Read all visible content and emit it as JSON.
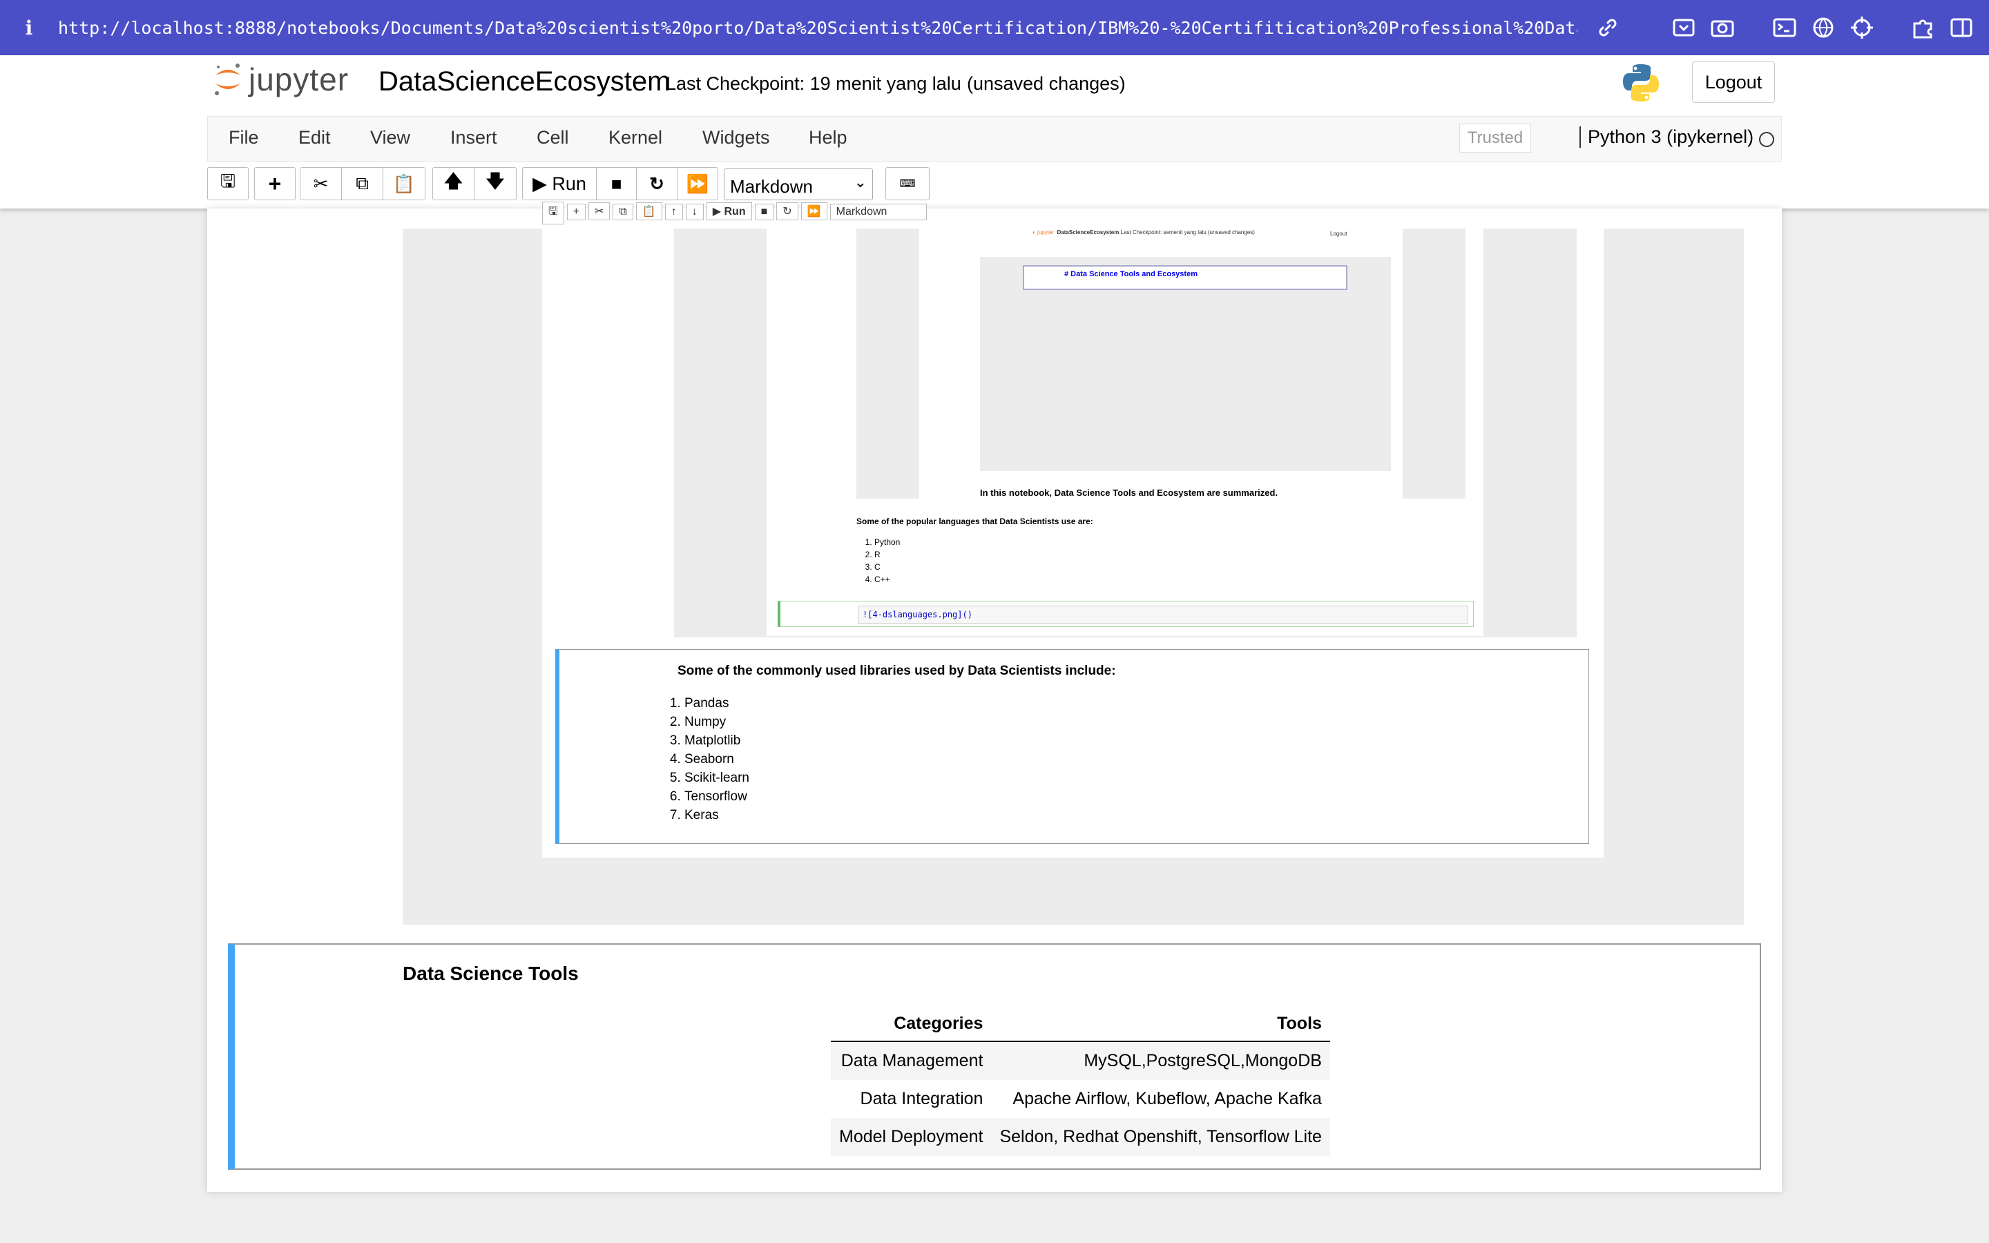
{
  "browser": {
    "info": "i",
    "url": "http://localhost:8888/notebooks/Documents/Data%20scientist%20porto/Data%20Scientist%20Certification/IBM%20-%20Certifitication%20Professional%20Data%20Scientist/Course%2…"
  },
  "header": {
    "logo": "jupyter",
    "title": "DataScienceEcosystem",
    "checkpoint": "Last Checkpoint: 19 menit yang lalu",
    "unsaved": "(unsaved changes)",
    "logout": "Logout"
  },
  "menu": {
    "items": [
      "File",
      "Edit",
      "View",
      "Insert",
      "Cell",
      "Kernel",
      "Widgets",
      "Help"
    ],
    "trusted": "Trusted",
    "kernel": "Python 3 (ipykernel)"
  },
  "toolbar": {
    "run": "Run",
    "cell_type": "Markdown"
  },
  "screenshot_nested": {
    "toolbar_run": "Run",
    "toolbar_celltype": "Markdown",
    "mini_title": "DataScienceEcosystem",
    "mini_checkpoint": "Last Checkpoint: semenit yang lalu (unsaved changes)",
    "mini_logout": "Logout",
    "cell_heading": "# Data Science Tools and Ecosystem",
    "intro": "In this notebook, Data Science Tools and Ecosystem are summarized.",
    "langs_heading": "Some of the popular languages that Data Scientists use are:",
    "langs": [
      "Python",
      "R",
      "C",
      "C++"
    ],
    "code": "![4-dslanguages.png]()"
  },
  "libraries": {
    "heading": "Some of the commonly used libraries used by Data Scientists include:",
    "items": [
      "Pandas",
      "Numpy",
      "Matplotlib",
      "Seaborn",
      "Scikit-learn",
      "Tensorflow",
      "Keras"
    ]
  },
  "tools": {
    "heading": "Data Science Tools",
    "columns": [
      "Categories",
      "Tools"
    ],
    "rows": [
      [
        "Data Management",
        "MySQL,PostgreSQL,MongoDB"
      ],
      [
        "Data Integration",
        "Apache Airflow, Kubeflow, Apache Kafka"
      ],
      [
        "Model Deployment",
        "Seldon, Redhat Openshift, Tensorflow Lite"
      ]
    ]
  }
}
